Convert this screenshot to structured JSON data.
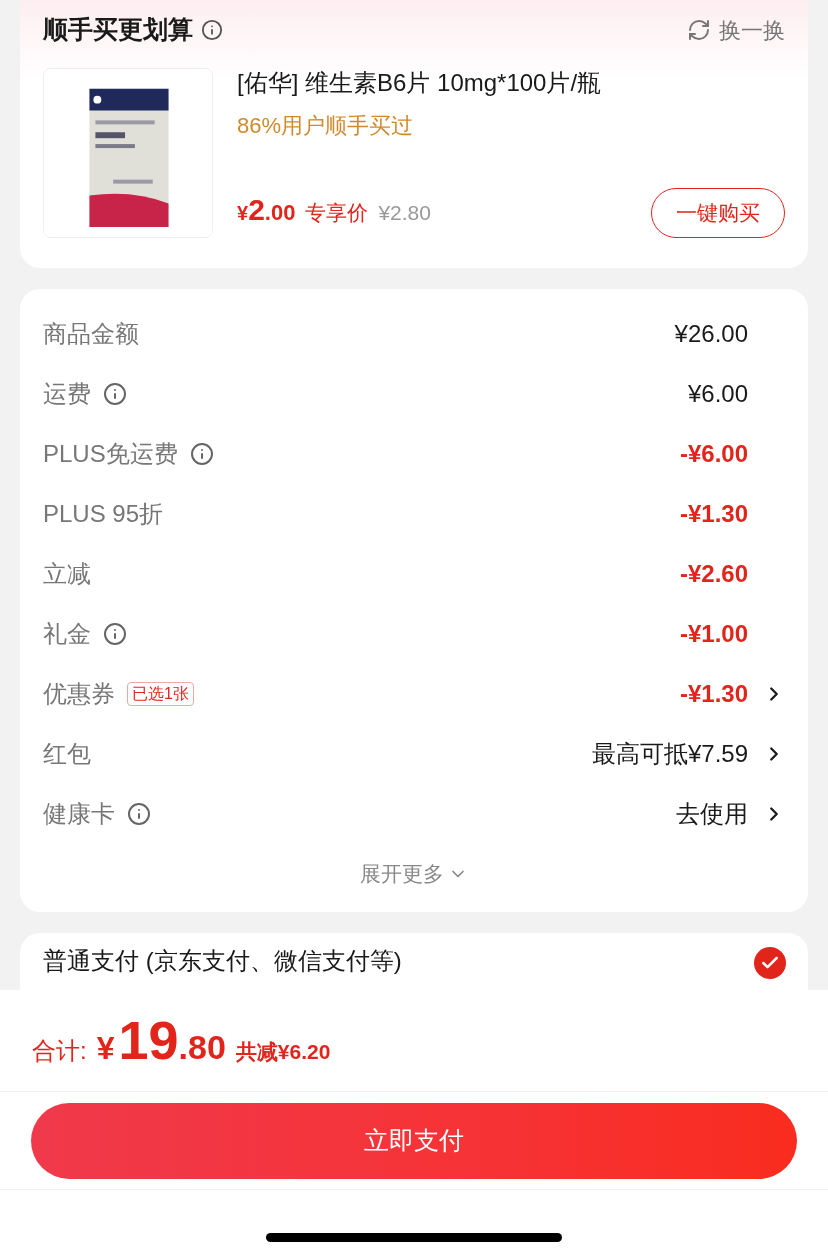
{
  "recommend": {
    "title": "顺手买更划算",
    "refresh": "换一换",
    "product": {
      "name": "[佑华] 维生素B6片 10mg*100片/瓶",
      "note": "86%用户顺手买过",
      "price_symbol": "¥",
      "price_int": "2",
      "price_dec": ".00",
      "price_label": "专享价",
      "original_price": "¥2.80",
      "buy_button": "一键购买"
    }
  },
  "summary": {
    "rows": [
      {
        "label": "商品金额",
        "info": false,
        "value": "¥26.00",
        "discount": false,
        "arrow": false
      },
      {
        "label": "运费",
        "info": true,
        "value": "¥6.00",
        "discount": false,
        "arrow": false
      },
      {
        "label": "PLUS免运费",
        "info": true,
        "value": "-¥6.00",
        "discount": true,
        "arrow": false
      },
      {
        "label": "PLUS 95折",
        "info": false,
        "value": "-¥1.30",
        "discount": true,
        "arrow": false
      },
      {
        "label": "立减",
        "info": false,
        "value": "-¥2.60",
        "discount": true,
        "arrow": false
      },
      {
        "label": "礼金",
        "info": true,
        "value": "-¥1.00",
        "discount": true,
        "arrow": false
      },
      {
        "label": "优惠券",
        "info": false,
        "tag": "已选1张",
        "value": "-¥1.30",
        "discount": true,
        "arrow": true
      },
      {
        "label": "红包",
        "info": false,
        "value": "最高可抵¥7.59",
        "discount": false,
        "arrow": true
      },
      {
        "label": "健康卡",
        "info": true,
        "value": "去使用",
        "discount": false,
        "arrow": true
      }
    ],
    "expand": "展开更多"
  },
  "payment": {
    "label": "普通支付 (京东支付、微信支付等)",
    "selected": true
  },
  "footer": {
    "total_label": "合计:",
    "symbol": "¥",
    "total_int": "19",
    "total_dec": ".80",
    "saved": "共减¥6.20",
    "pay_button": "立即支付"
  }
}
